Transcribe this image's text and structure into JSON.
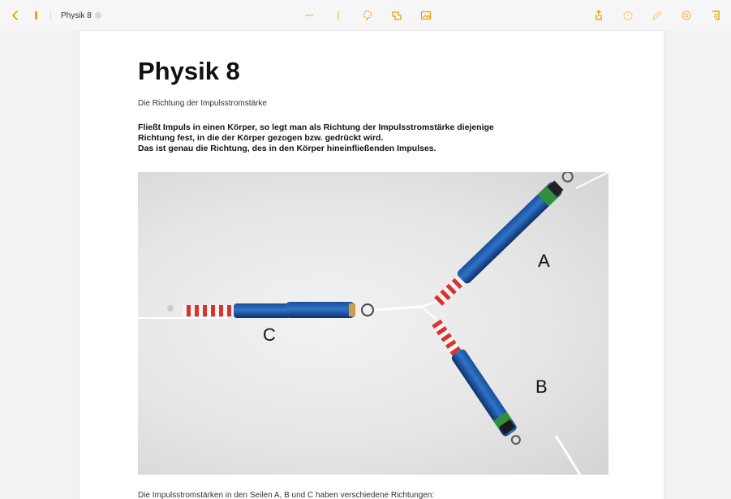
{
  "toolbar": {
    "doc_title": "Physik 8",
    "left_icons": [
      "back-chevron-icon",
      "sidebar-marker-icon"
    ],
    "center_icons": [
      "minus-icon",
      "text-cursor-icon",
      "lasso-icon",
      "shapes-icon",
      "image-icon"
    ],
    "right_icons": [
      "share-icon",
      "timer-icon",
      "pen-icon",
      "settings-icon",
      "more-icon"
    ],
    "accent_color": "#f0a000"
  },
  "page": {
    "title": "Physik 8",
    "subtitle": "Die Richtung der Impulsstromstärke",
    "paragraph_lines": [
      "Fließt Impuls in einen Körper, so legt man als Richtung der Impulsstromstärke diejenige",
      "Richtung fest, in die der Körper gezogen bzw. gedrückt wird.",
      "Das ist genau die Richtung, des in den Körper hineinfließenden Impulses."
    ],
    "photo_labels": {
      "a": "A",
      "b": "B",
      "c": "C"
    },
    "caption": "Die Impulsstromstärken in den Seilen A, B und C haben verschiedene Richtungen:"
  }
}
